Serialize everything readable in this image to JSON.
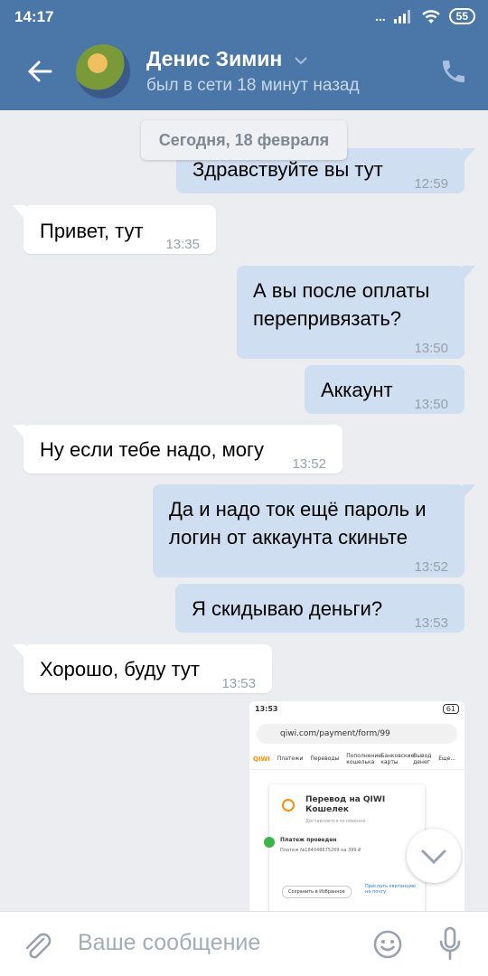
{
  "status_bar": {
    "time": "14:17",
    "signal": "...",
    "battery": "55"
  },
  "header": {
    "name": "Денис Зимин",
    "last_seen": "был в сети 18 минут назад",
    "back_icon": "arrow-left-icon",
    "call_icon": "phone-icon"
  },
  "date_chip": "Сегодня, 18 февраля",
  "messages": [
    {
      "dir": "out",
      "text": "Здравствуйте вы тут",
      "time": "12:59"
    },
    {
      "dir": "in",
      "text": "Привет, тут",
      "time": "13:35"
    },
    {
      "dir": "out",
      "text": "А вы после оплаты\nперепривязать?",
      "time": "13:50"
    },
    {
      "dir": "out",
      "text": "Аккаунт",
      "time": "13:50"
    },
    {
      "dir": "in",
      "text": "Ну если тебе надо, могу",
      "time": "13:52"
    },
    {
      "dir": "out",
      "text": "Да и надо ток ещё пароль и\nлогин от аккаунта скиньте",
      "time": "13:52"
    },
    {
      "dir": "out",
      "text": "Я скидываю деньги?",
      "time": "13:53"
    },
    {
      "dir": "in",
      "text": "Хорошо, буду тут",
      "time": "13:53"
    }
  ],
  "attachment": {
    "time": "13:53",
    "battery": "61",
    "url": "qiwi.com/payment/form/99",
    "nav_logo": "QIWI",
    "nav_items": [
      "Платежи",
      "Переводы",
      "Пополнение кошелька",
      "Банковские карты",
      "Вывод денег",
      "Еще..."
    ],
    "card_title": "Перевод на QIWI Кошелек",
    "card_subtitle": "Доставляется мгновенно",
    "payment_status": "Платеж проведен",
    "payment_number": "Платеж №184048675269 на 399 ₽",
    "favorite_label": "Сохранить в Избранное",
    "receipt_label": "Прислать квитанцию на почту"
  },
  "input": {
    "placeholder": "Ваше сообщение",
    "attach_icon": "paperclip-icon",
    "emoji_icon": "smile-icon",
    "mic_icon": "microphone-icon"
  },
  "colors": {
    "header": "#4a76a8",
    "bubble_out": "#cfdef0",
    "bubble_in": "#ffffff",
    "background": "#ebedf0"
  }
}
